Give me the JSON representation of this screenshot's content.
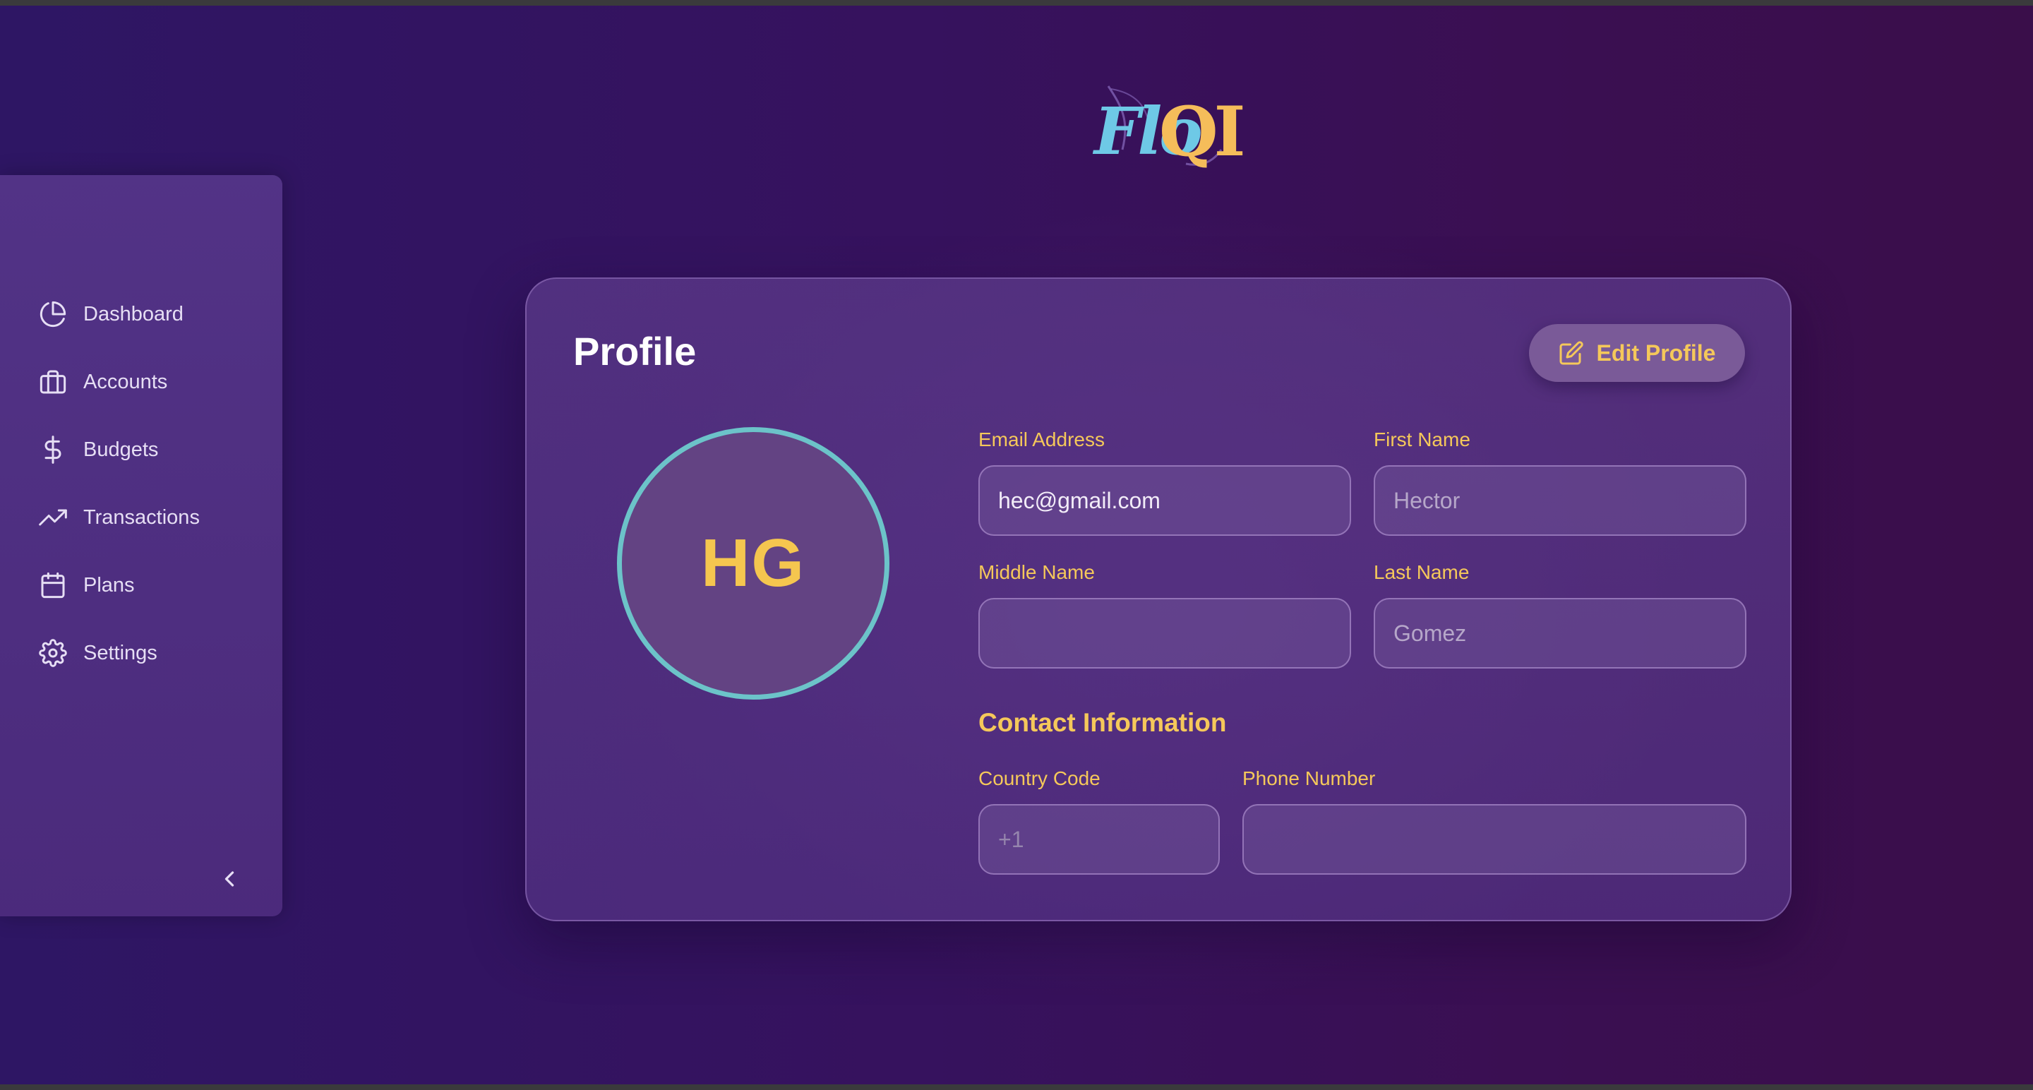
{
  "logo": {
    "text_left": "Flo",
    "text_right": "QI"
  },
  "sidebar": {
    "items": [
      {
        "label": "Dashboard",
        "icon": "pie-chart-icon"
      },
      {
        "label": "Accounts",
        "icon": "briefcase-icon"
      },
      {
        "label": "Budgets",
        "icon": "dollar-icon"
      },
      {
        "label": "Transactions",
        "icon": "trending-up-icon"
      },
      {
        "label": "Plans",
        "icon": "calendar-icon"
      },
      {
        "label": "Settings",
        "icon": "gear-icon"
      }
    ],
    "collapse_icon": "chevron-left-icon"
  },
  "profile": {
    "title": "Profile",
    "edit_button": "Edit Profile",
    "avatar_initials": "HG",
    "email": {
      "label": "Email Address",
      "value": "hec@gmail.com"
    },
    "first_name": {
      "label": "First Name",
      "value": "Hector"
    },
    "middle_name": {
      "label": "Middle Name",
      "value": ""
    },
    "last_name": {
      "label": "Last Name",
      "value": "Gomez"
    },
    "contact_title": "Contact Information",
    "country_code": {
      "label": "Country Code",
      "placeholder": "+1"
    },
    "phone_number": {
      "label": "Phone Number",
      "value": ""
    }
  },
  "colors": {
    "accent": "#f5c85a",
    "avatar_ring": "#6cc3c9",
    "background": "#2c1456"
  }
}
